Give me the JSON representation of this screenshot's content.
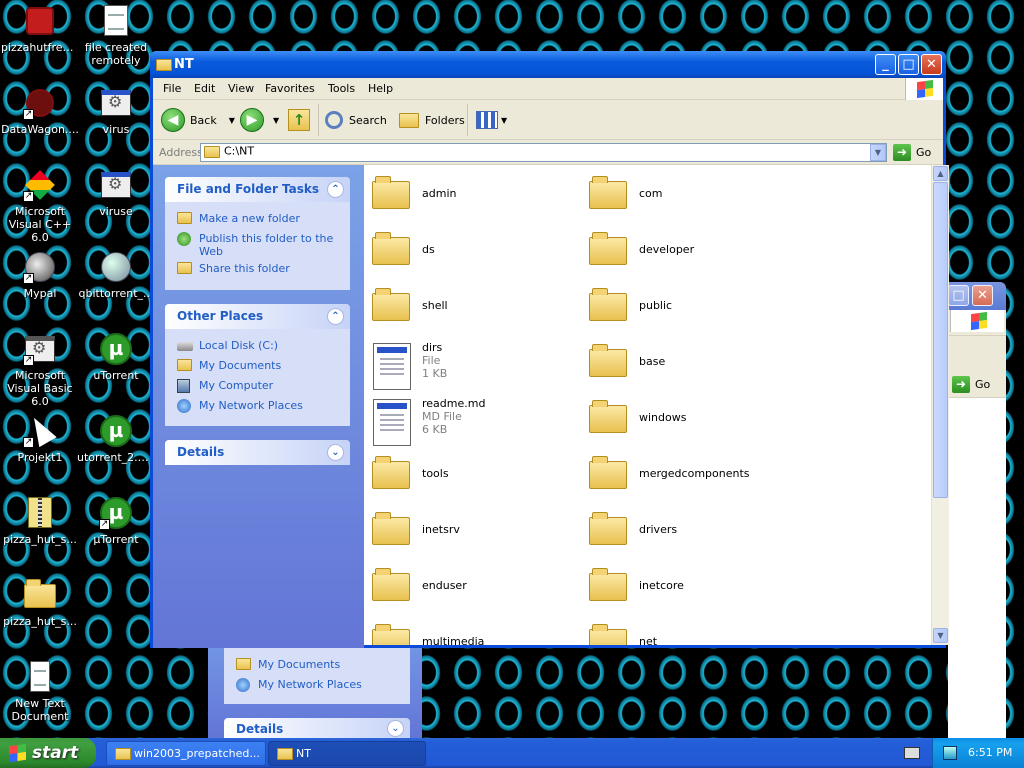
{
  "desktop": {
    "icons": [
      {
        "label": "pizzahutfree...",
        "icon": "red-printer-icon"
      },
      {
        "label": "file created remotely",
        "icon": "document-icon"
      },
      {
        "label": "DataWagon....",
        "icon": "datawagon-icon"
      },
      {
        "label": "virus",
        "icon": "application-icon"
      },
      {
        "label": "Microsoft Visual C++ 6.0",
        "icon": "msvc-icon"
      },
      {
        "label": "viruse",
        "icon": "application-icon"
      },
      {
        "label": "Mypal",
        "icon": "mypal-icon"
      },
      {
        "label": "qbittorrent_...",
        "icon": "qbittorrent-icon"
      },
      {
        "label": "Microsoft Visual Basic 6.0",
        "icon": "vb6-icon"
      },
      {
        "label": "uTorrent",
        "icon": "utorrent-icon"
      },
      {
        "label": "Projekt1",
        "icon": "cursor-icon"
      },
      {
        "label": "utorrent_2.2...",
        "icon": "utorrent-icon"
      },
      {
        "label": "pizza_hut_s...",
        "icon": "zip-icon"
      },
      {
        "label": "µTorrent",
        "icon": "utorrent-icon"
      },
      {
        "label": "pizza_hut_s...",
        "icon": "folder-icon"
      },
      {
        "label": "New Text Document",
        "icon": "text-document-icon"
      }
    ]
  },
  "background_window": {
    "panel_items": [
      "My Documents",
      "My Network Places"
    ],
    "details_label": "Details",
    "go_label": "Go"
  },
  "window": {
    "title": "NT",
    "menu": [
      "File",
      "Edit",
      "View",
      "Favorites",
      "Tools",
      "Help"
    ],
    "toolbar": {
      "back": "Back",
      "search": "Search",
      "folders": "Folders"
    },
    "address_label": "Address",
    "address_value": "C:\\NT",
    "go_label": "Go",
    "file_tasks": {
      "title": "File and Folder Tasks",
      "items": [
        "Make a new folder",
        "Publish this folder to the Web",
        "Share this folder"
      ]
    },
    "other_places": {
      "title": "Other Places",
      "items": [
        "Local Disk (C:)",
        "My Documents",
        "My Computer",
        "My Network Places"
      ]
    },
    "details_title": "Details",
    "files": [
      {
        "name": "admin",
        "kind": "folder"
      },
      {
        "name": "com",
        "kind": "folder"
      },
      {
        "name": "ds",
        "kind": "folder"
      },
      {
        "name": "developer",
        "kind": "folder"
      },
      {
        "name": "shell",
        "kind": "folder"
      },
      {
        "name": "public",
        "kind": "folder"
      },
      {
        "name": "dirs",
        "kind": "file",
        "type": "File",
        "size": "1 KB"
      },
      {
        "name": "base",
        "kind": "folder"
      },
      {
        "name": "readme.md",
        "kind": "file",
        "type": "MD File",
        "size": "6 KB"
      },
      {
        "name": "windows",
        "kind": "folder"
      },
      {
        "name": "tools",
        "kind": "folder"
      },
      {
        "name": "mergedcomponents",
        "kind": "folder"
      },
      {
        "name": "inetsrv",
        "kind": "folder"
      },
      {
        "name": "drivers",
        "kind": "folder"
      },
      {
        "name": "enduser",
        "kind": "folder"
      },
      {
        "name": "inetcore",
        "kind": "folder"
      },
      {
        "name": "multimedia",
        "kind": "folder"
      },
      {
        "name": "net",
        "kind": "folder"
      }
    ]
  },
  "taskbar": {
    "start_label": "start",
    "tasks": [
      "win2003_prepatched...",
      "NT"
    ],
    "clock": "6:51 PM"
  }
}
